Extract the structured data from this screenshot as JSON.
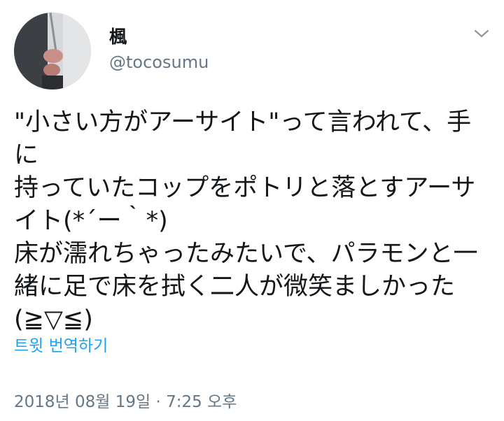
{
  "author": {
    "display_name": "楓",
    "handle": "@tocosumu",
    "avatar_icon": "user-avatar-photo"
  },
  "menu": {
    "icon": "chevron-down-icon"
  },
  "tweet": {
    "text": "\"小さい方がアーサイト\"って言われて、手に\n持っていたコップをポトリと落とすアーサ\nイト(*´ー｀*)\n床が濡れちゃったみたいで、パラモンと一\n緒に足で床を拭く二人が微笑ましかった\n(≧▽≦)"
  },
  "actions": {
    "translate_label": "트윗 번역하기"
  },
  "meta": {
    "timestamp": "2018년 08월 19일 · 7:25 오후"
  },
  "colors": {
    "link": "#1da1f2",
    "secondary_text": "#657786",
    "primary_text": "#14171a"
  }
}
